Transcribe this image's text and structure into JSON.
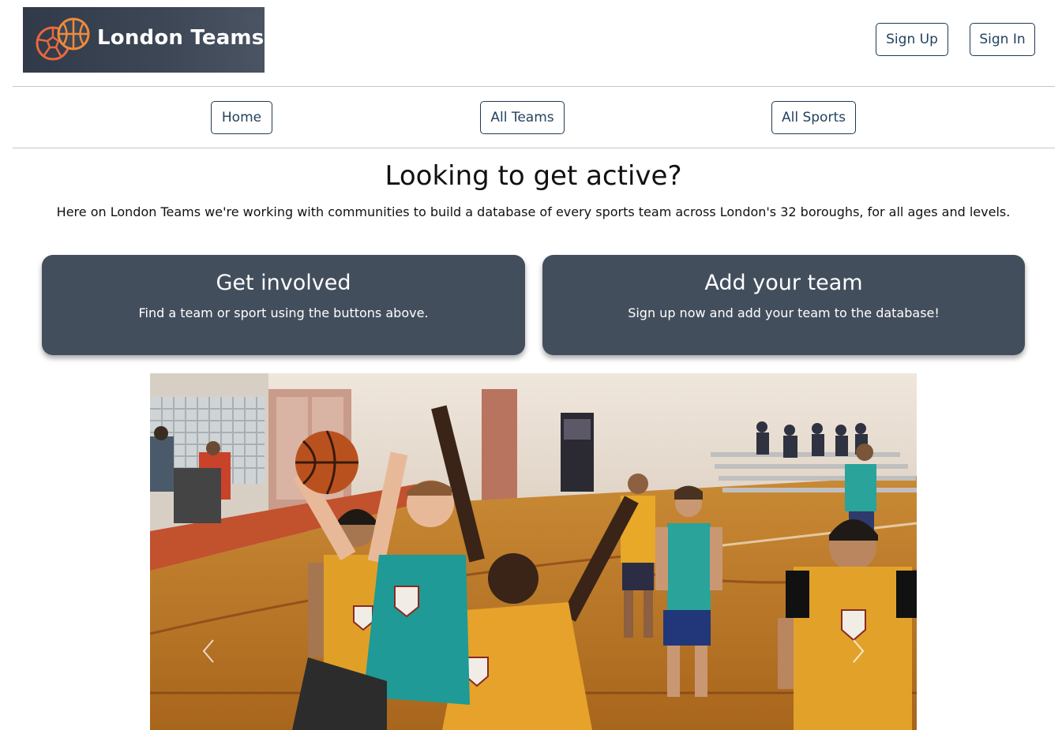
{
  "header": {
    "logo_text": "London Teams",
    "logo_icon": "sports-balls-icon",
    "signup_label": "Sign Up",
    "signin_label": "Sign In"
  },
  "nav": {
    "items": [
      {
        "label": "Home"
      },
      {
        "label": "All Teams"
      },
      {
        "label": "All Sports"
      }
    ]
  },
  "hero": {
    "title": "Looking to get active?",
    "subtitle": "Here on London Teams we're working with communities to build a database of every sports team across London's 32 boroughs, for all ages and levels."
  },
  "cards": [
    {
      "title": "Get involved",
      "text": "Find a team or sport using the buttons above."
    },
    {
      "title": "Add your team",
      "text": "Sign up now and add your team to the database!"
    }
  ],
  "carousel": {
    "image": "basketball-game-photo",
    "prev_icon": "chevron-left-icon",
    "next_icon": "chevron-right-icon"
  },
  "colors": {
    "brand_dark": "#434e5d",
    "button_border": "#1f3a54",
    "logo_orange": "#e9683f"
  }
}
